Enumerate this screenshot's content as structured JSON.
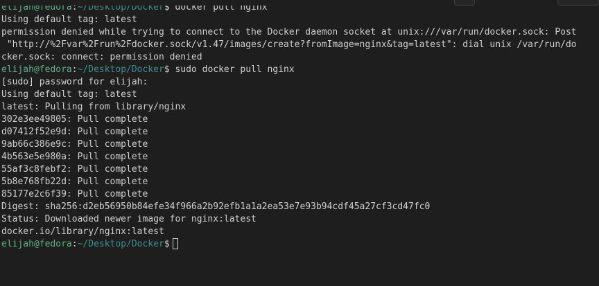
{
  "terminal": {
    "prompt": {
      "user": "elijah",
      "at": "@",
      "host": "fedora",
      "colon": ":",
      "path_1": "~/Desktop/Docker",
      "dollar": "$"
    },
    "commands": {
      "cmd_1": " docker pull nginx",
      "cmd_2": " sudo docker pull nginx"
    },
    "output": {
      "l1": "Using default tag: latest",
      "l2": "permission denied while trying to connect to the Docker daemon socket at unix:///var/run/docker.sock: Post",
      "l3": " \"http://%2Fvar%2Frun%2Fdocker.sock/v1.47/images/create?fromImage=nginx&tag=latest\": dial unix /var/run/do",
      "l4": "cker.sock: connect: permission denied",
      "l5": "[sudo] password for elijah:",
      "l6": "Using default tag: latest",
      "l7": "latest: Pulling from library/nginx",
      "l8": "302e3ee49805: Pull complete",
      "l9": "d07412f52e9d: Pull complete",
      "l10": "9ab66c386e9c: Pull complete",
      "l11": "4b563e5e980a: Pull complete",
      "l12": "55af3c8febf2: Pull complete",
      "l13": "5b8e768fb22d: Pull complete",
      "l14": "85177e2c6f39: Pull complete",
      "l15": "Digest: sha256:d2eb56950b84efe34f966a2b92efb1a1a2ea53e7e93b94cdf45a27cf3cd47fc0",
      "l16": "Status: Downloaded newer image for nginx:latest",
      "l17": "docker.io/library/nginx:latest"
    },
    "colors": {
      "background": "#1e1e1e",
      "text": "#d0d0d0",
      "user_host": "#5db38b",
      "path": "#3d8f8f"
    }
  }
}
